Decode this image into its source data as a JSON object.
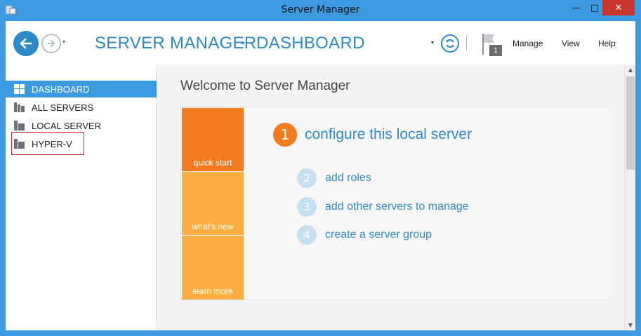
{
  "window": {
    "title": "Server Manager",
    "minimize_glyph": "—",
    "maximize_glyph": "□",
    "close_glyph": "✕"
  },
  "header": {
    "breadcrumb_root": "SERVER MANAGER",
    "breadcrumb_separator": "▸",
    "breadcrumb_current": "DASHBOARD",
    "nav_dropdown_glyph": "▾",
    "refresh_dropdown_glyph": "▾",
    "notification_count": "1",
    "menu": {
      "manage": "Manage",
      "view": "View",
      "help": "Help"
    }
  },
  "sidebar": {
    "items": [
      {
        "label": "DASHBOARD",
        "active": true
      },
      {
        "label": "ALL SERVERS",
        "active": false
      },
      {
        "label": "LOCAL SERVER",
        "active": false
      },
      {
        "label": "HYPER-V",
        "active": false
      }
    ]
  },
  "main": {
    "welcome": "Welcome to Server Manager",
    "tiles": {
      "quick_start": "quick start",
      "whats_new": "what's new",
      "learn_more": "learn more"
    },
    "steps": [
      {
        "num": "1",
        "label": "configure this local server"
      },
      {
        "num": "2",
        "label": "add roles"
      },
      {
        "num": "3",
        "label": "add other servers to manage"
      },
      {
        "num": "4",
        "label": "create a server group"
      }
    ]
  },
  "scrollbar": {
    "up_glyph": "▲",
    "down_glyph": "▼"
  },
  "colors": {
    "titlebar": "#3c9be0",
    "accent": "#2d8ac7",
    "sidebar_active": "#3c9be0",
    "tile_primary": "#f37a1f",
    "tile_secondary": "#fbaf42",
    "close_button": "#c7352d",
    "highlight_box": "#b3272c"
  }
}
